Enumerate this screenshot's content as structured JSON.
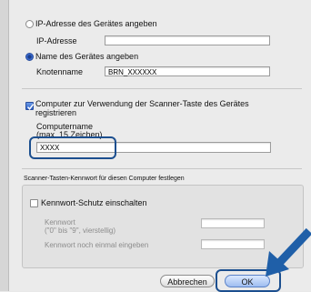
{
  "options": {
    "ip_radio_label": "IP-Adresse des Gerätes angeben",
    "ip_field_label": "IP-Adresse",
    "ip_value": "",
    "node_radio_label": "Name des Gerätes angeben",
    "node_field_label": "Knotenname",
    "node_value": "BRN_XXXXXX"
  },
  "computer": {
    "checkbox_label_line1": "Computer zur Verwendung der Scanner-Taste des Gerätes",
    "checkbox_label_line2": "registrieren",
    "name_label": "Computername",
    "name_hint": "(max. 15 Zeichen)",
    "name_value": "XXXX"
  },
  "password": {
    "section_title": "Scanner-Tasten-Kennwort für diesen Computer festlegen",
    "enable_label": "Kennwort-Schutz einschalten",
    "password_label": "Kennwort",
    "password_hint": "(\"0\" bis \"9\", vierstellig)",
    "password_value": "",
    "confirm_label": "Kennwort noch einmal eingeben",
    "confirm_value": ""
  },
  "buttons": {
    "cancel": "Abbrechen",
    "ok": "OK"
  },
  "colors": {
    "highlight": "#1c4f8f",
    "arrow": "#1f5fa8"
  }
}
